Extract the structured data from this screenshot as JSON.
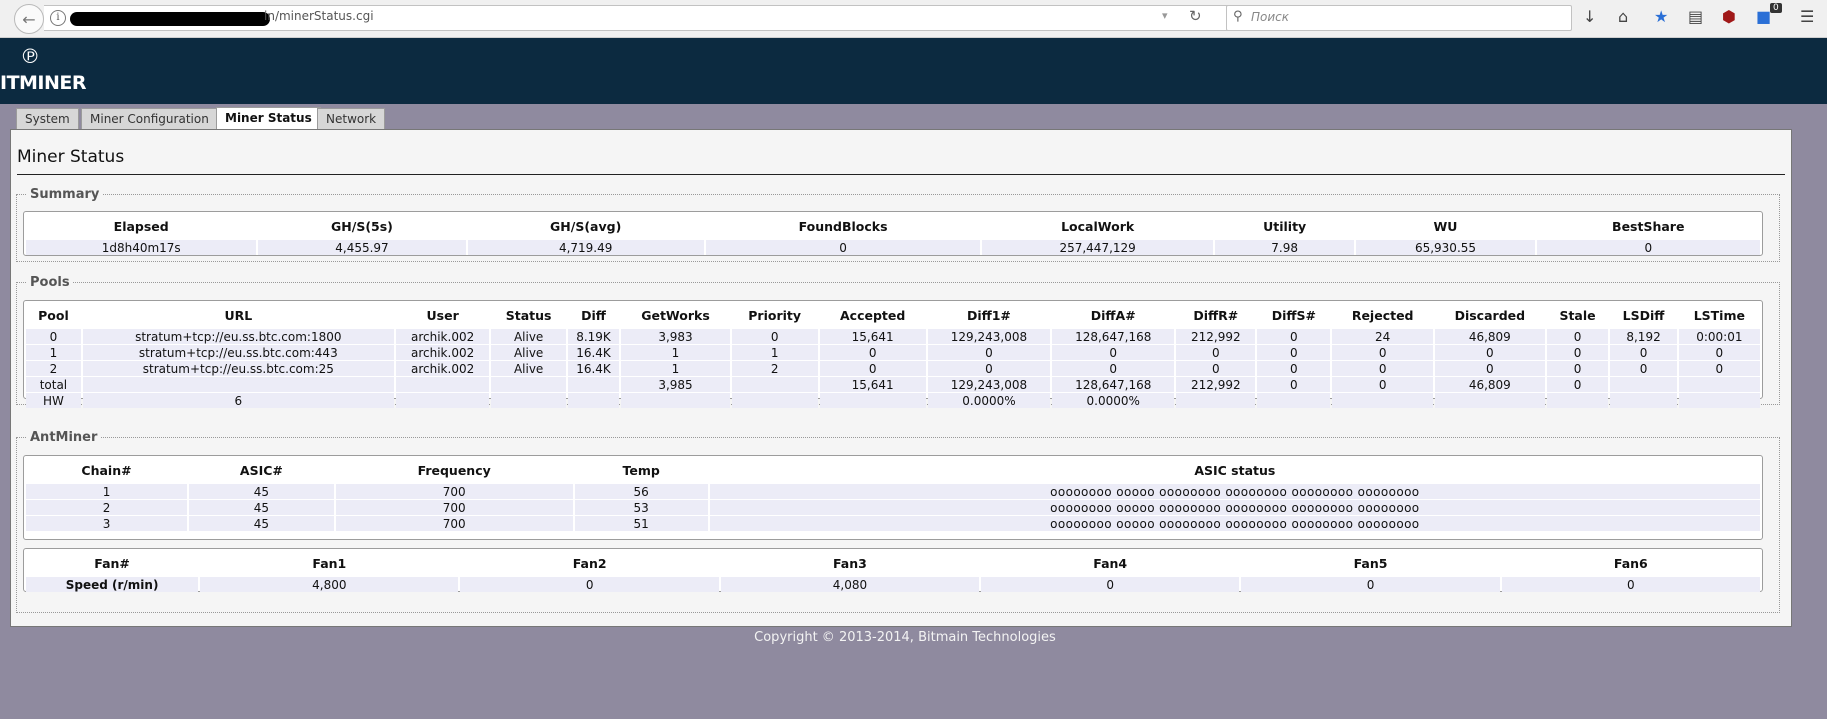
{
  "browser": {
    "url_visible": "in/minerStatus.cgi",
    "search_placeholder": "Поиск",
    "badge_count": "0"
  },
  "brand": {
    "logo_text": "ITMINER"
  },
  "tabs": [
    {
      "label": "System"
    },
    {
      "label": "Miner Configuration"
    },
    {
      "label": "Miner Status",
      "active": true
    },
    {
      "label": "Network"
    }
  ],
  "page": {
    "title": "Miner Status"
  },
  "summary": {
    "legend": "Summary",
    "headers": [
      "Elapsed",
      "GH/S(5s)",
      "GH/S(avg)",
      "FoundBlocks",
      "LocalWork",
      "Utility",
      "WU",
      "BestShare"
    ],
    "row": [
      "1d8h40m17s",
      "4,455.97",
      "4,719.49",
      "0",
      "257,447,129",
      "7.98",
      "65,930.55",
      "0"
    ]
  },
  "pools": {
    "legend": "Pools",
    "headers": [
      "Pool",
      "URL",
      "User",
      "Status",
      "Diff",
      "GetWorks",
      "Priority",
      "Accepted",
      "Diff1#",
      "DiffA#",
      "DiffR#",
      "DiffS#",
      "Rejected",
      "Discarded",
      "Stale",
      "LSDiff",
      "LSTime"
    ],
    "rows": [
      [
        "0",
        "stratum+tcp://eu.ss.btc.com:1800",
        "archik.002",
        "Alive",
        "8.19K",
        "3,983",
        "0",
        "15,641",
        "129,243,008",
        "128,647,168",
        "212,992",
        "0",
        "24",
        "46,809",
        "0",
        "8,192",
        "0:00:01"
      ],
      [
        "1",
        "stratum+tcp://eu.ss.btc.com:443",
        "archik.002",
        "Alive",
        "16.4K",
        "1",
        "1",
        "0",
        "0",
        "0",
        "0",
        "0",
        "0",
        "0",
        "0",
        "0",
        "0"
      ],
      [
        "2",
        "stratum+tcp://eu.ss.btc.com:25",
        "archik.002",
        "Alive",
        "16.4K",
        "1",
        "2",
        "0",
        "0",
        "0",
        "0",
        "0",
        "0",
        "0",
        "0",
        "0",
        "0"
      ],
      [
        "total",
        "",
        "",
        "",
        "",
        "3,985",
        "",
        "15,641",
        "129,243,008",
        "128,647,168",
        "212,992",
        "0",
        "0",
        "46,809",
        "0",
        "",
        ""
      ],
      [
        "HW",
        "6",
        "",
        "",
        "",
        "",
        "",
        "",
        "0.0000%",
        "0.0000%",
        "",
        "",
        "",
        "",
        "",
        "",
        ""
      ]
    ]
  },
  "antminer": {
    "legend": "AntMiner",
    "headers": [
      "Chain#",
      "ASIC#",
      "Frequency",
      "Temp",
      "ASIC status"
    ],
    "rows": [
      [
        "1",
        "45",
        "700",
        "56",
        "oooooooo ooooo oooooooo oooooooo oooooooo oooooooo"
      ],
      [
        "2",
        "45",
        "700",
        "53",
        "oooooooo ooooo oooooooo oooooooo oooooooo oooooooo"
      ],
      [
        "3",
        "45",
        "700",
        "51",
        "oooooooo ooooo oooooooo oooooooo oooooooo oooooooo"
      ]
    ],
    "fan_headers": [
      "Fan#",
      "Fan1",
      "Fan2",
      "Fan3",
      "Fan4",
      "Fan5",
      "Fan6"
    ],
    "fan_row": [
      "Speed (r/min)",
      "4,800",
      "0",
      "4,080",
      "0",
      "0",
      "0"
    ]
  },
  "footer": {
    "copyright": "Copyright © 2013-2014, Bitmain Technologies"
  }
}
